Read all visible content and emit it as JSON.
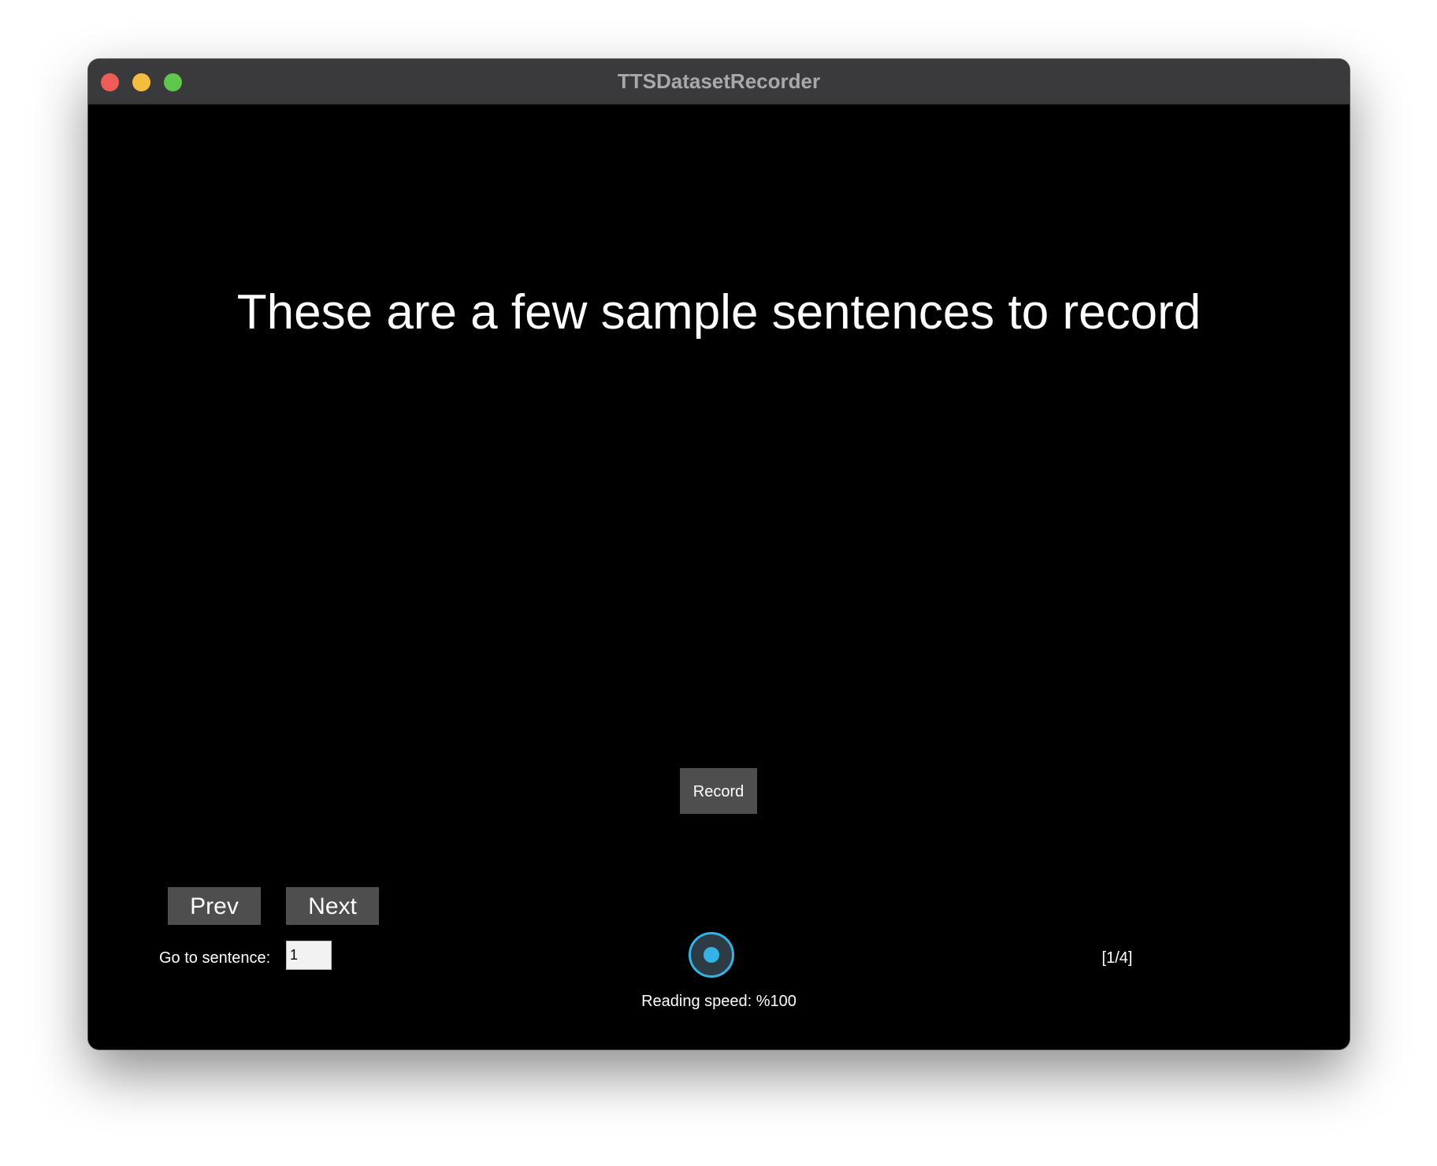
{
  "window": {
    "title": "TTSDatasetRecorder"
  },
  "main": {
    "sentence": "These are a few sample sentences to record",
    "record_label": "Record"
  },
  "navigation": {
    "prev_label": "Prev",
    "next_label": "Next",
    "goto_label": "Go to sentence:",
    "goto_value": "1",
    "counter": "[1/4]"
  },
  "speed": {
    "label": "Reading speed: %100",
    "value_percent": 100
  },
  "colors": {
    "background": "#000000",
    "titlebar": "#3a393c",
    "button": "#4e4e4e",
    "slider_accent": "#33b3e6",
    "close": "#ee5d55",
    "minimize": "#f5bd3f",
    "maximize": "#5dc84c"
  }
}
